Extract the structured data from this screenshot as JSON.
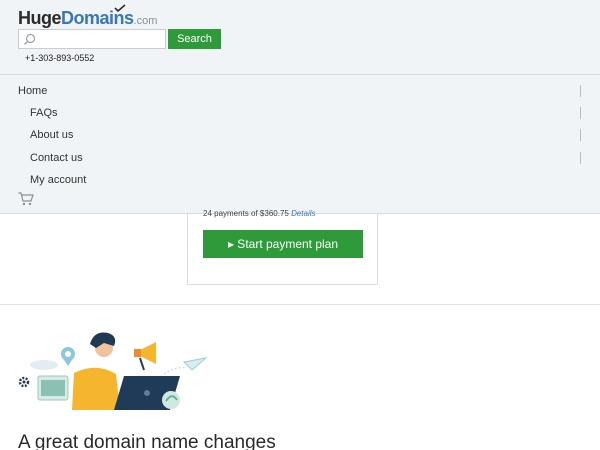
{
  "logo": {
    "part1": "Huge",
    "part2": "Domains",
    "part3": ".com"
  },
  "search": {
    "placeholder": "",
    "button_label": "Search"
  },
  "phone": "+1-303-893-0552",
  "nav": {
    "items": [
      {
        "label": "Home"
      },
      {
        "label": "FAQs"
      },
      {
        "label": "About us"
      },
      {
        "label": "Contact us"
      },
      {
        "label": "My account"
      }
    ]
  },
  "payment": {
    "text": "24 payments of $360.75",
    "details_link": "Details",
    "button_label": "▸ Start payment plan"
  },
  "headline": "A great domain name changes",
  "colors": {
    "accent_green": "#2e9a3a",
    "brand_blue": "#3a77b8"
  }
}
